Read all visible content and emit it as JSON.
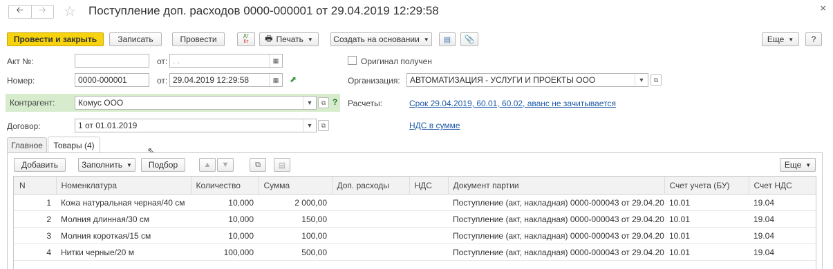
{
  "window": {
    "title": "Поступление доп. расходов 0000-000001 от 29.04.2019 12:29:58",
    "close_glyph": "×"
  },
  "toolbar": {
    "post_close": "Провести и закрыть",
    "save": "Записать",
    "post": "Провести",
    "print": "Печать",
    "create_based": "Создать на основании",
    "more": "Еще",
    "help": "?"
  },
  "form": {
    "act_label": "Акт №:",
    "act_value": "",
    "act_date_label": "от:",
    "act_date_value": ". .",
    "original_label": "Оригинал получен",
    "number_label": "Номер:",
    "number_value": "0000-000001",
    "date_label": "от:",
    "date_value": "29.04.2019 12:29:58",
    "org_label": "Организация:",
    "org_value": "АВТОМАТИЗАЦИЯ - УСЛУГИ И ПРОЕКТЫ ООО",
    "contractor_label": "Контрагент:",
    "contractor_value": "Комус ООО",
    "contractor_help": "?",
    "payments_label": "Расчеты:",
    "payments_link": "Срок 29.04.2019, 60.01, 60.02, аванс не зачитывается",
    "contract_label": "Договор:",
    "contract_value": "1 от 01.01.2019",
    "vat_link": "НДС в сумме"
  },
  "tabs": [
    {
      "label": "Главное"
    },
    {
      "label": "Товары (4)"
    }
  ],
  "table_toolbar": {
    "add": "Добавить",
    "fill": "Заполнить",
    "select": "Подбор",
    "more": "Еще"
  },
  "table": {
    "columns": [
      "N",
      "Номенклатура",
      "Количество",
      "Сумма",
      "Доп. расходы",
      "НДС",
      "Документ партии",
      "Счет учета (БУ)",
      "Счет НДС"
    ],
    "rows": [
      {
        "n": "1",
        "name": "Кожа натуральная черная/40 см",
        "qty": "10,000",
        "sum": "2 000,00",
        "extra": "",
        "vat": "",
        "doc": "Поступление (акт, накладная) 0000-000043 от 29.04.20...",
        "acc": "10.01",
        "vat_acc": "19.04"
      },
      {
        "n": "2",
        "name": "Молния длинная/30 см",
        "qty": "10,000",
        "sum": "150,00",
        "extra": "",
        "vat": "",
        "doc": "Поступление (акт, накладная) 0000-000043 от 29.04.20...",
        "acc": "10.01",
        "vat_acc": "19.04"
      },
      {
        "n": "3",
        "name": "Молния короткая/15 см",
        "qty": "10,000",
        "sum": "100,00",
        "extra": "",
        "vat": "",
        "doc": "Поступление (акт, накладная) 0000-000043 от 29.04.20...",
        "acc": "10.01",
        "vat_acc": "19.04"
      },
      {
        "n": "4",
        "name": "Нитки черные/20 м",
        "qty": "100,000",
        "sum": "500,00",
        "extra": "",
        "vat": "",
        "doc": "Поступление (акт, накладная) 0000-000043 от 29.04.20...",
        "acc": "10.01",
        "vat_acc": "19.04"
      }
    ]
  }
}
